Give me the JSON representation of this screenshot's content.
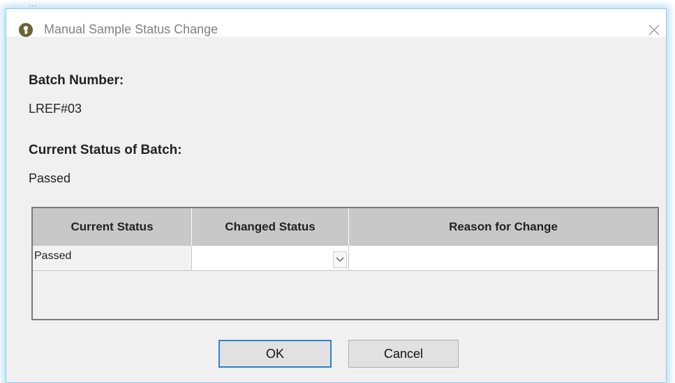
{
  "window": {
    "title": "Manual Sample Status Change"
  },
  "batch": {
    "number_label": "Batch Number:",
    "number_value": "LREF#03",
    "status_label": "Current Status of Batch:",
    "status_value": "Passed"
  },
  "grid": {
    "columns": [
      "Current Status",
      "Changed Status",
      "Reason for Change"
    ],
    "rows": [
      {
        "current_status": "Passed",
        "changed_status": "",
        "reason": ""
      }
    ]
  },
  "buttons": {
    "ok_label": "OK",
    "cancel_label": "Cancel"
  },
  "icons": {
    "title_icon": "key-icon",
    "close_icon": "close-icon",
    "dropdown_icon": "chevron-down-icon"
  },
  "colors": {
    "dialog_background": "#f0f0f0",
    "header_background": "#c8c8c8",
    "default_button_border": "#2f7fd0",
    "window_glow": "#8ecbee"
  }
}
